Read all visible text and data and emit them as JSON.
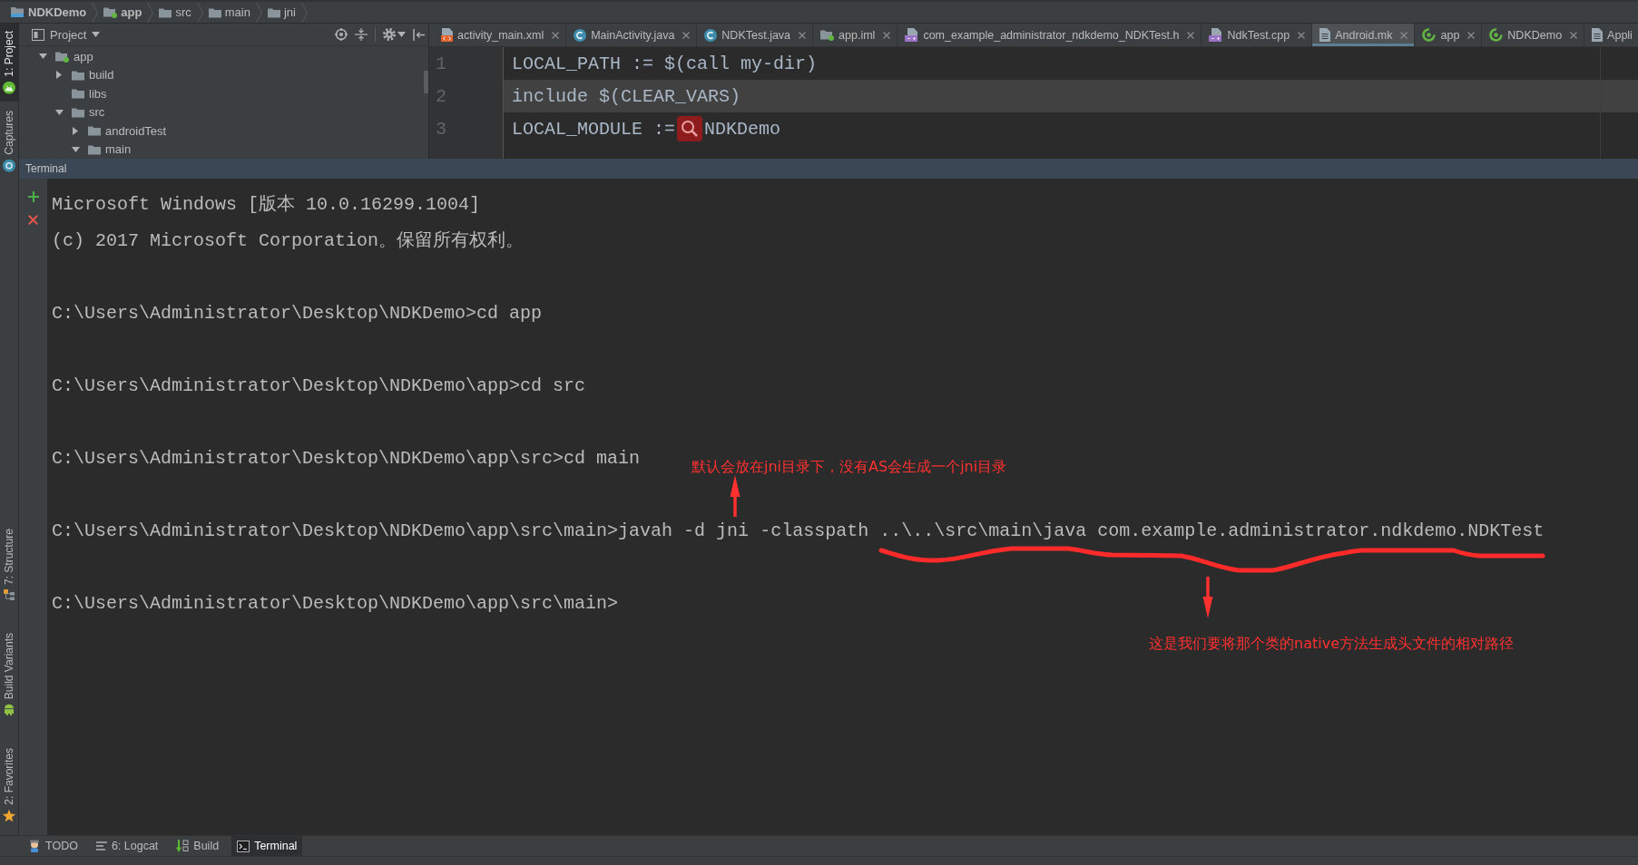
{
  "breadcrumb": [
    {
      "label": "NDKDemo",
      "kind": "project"
    },
    {
      "label": "app",
      "kind": "module"
    },
    {
      "label": "src",
      "kind": "folder"
    },
    {
      "label": "main",
      "kind": "folder"
    },
    {
      "label": "jni",
      "kind": "folder"
    }
  ],
  "tool_strip": {
    "top": [
      {
        "label": "1: Project",
        "kind": "project",
        "selected": true
      },
      {
        "label": "Captures",
        "kind": "captures",
        "selected": false
      }
    ],
    "bottom": [
      {
        "label": "7: Structure",
        "kind": "structure",
        "selected": false
      },
      {
        "label": "Build Variants",
        "kind": "build_variants",
        "selected": false
      },
      {
        "label": "2: Favorites",
        "kind": "favorites",
        "selected": false
      }
    ]
  },
  "project_panel": {
    "title": "Project",
    "tree": [
      {
        "label": "app",
        "kind": "module",
        "expanded": true,
        "children": [
          {
            "label": "build",
            "kind": "folder",
            "expanded": false
          },
          {
            "label": "libs",
            "kind": "folder"
          },
          {
            "label": "src",
            "kind": "folder",
            "expanded": true,
            "children": [
              {
                "label": "androidTest",
                "kind": "folder",
                "expanded": false
              },
              {
                "label": "main",
                "kind": "folder",
                "expanded": true
              }
            ]
          }
        ]
      }
    ]
  },
  "editor": {
    "tabs": [
      {
        "label": "activity_main.xml",
        "kind": "xml",
        "selected": false,
        "closable": true
      },
      {
        "label": "MainActivity.java",
        "kind": "class",
        "selected": false,
        "closable": true
      },
      {
        "label": "NDKTest.java",
        "kind": "class",
        "selected": false,
        "closable": true
      },
      {
        "label": "app.iml",
        "kind": "module",
        "selected": false,
        "closable": true
      },
      {
        "label": "com_example_administrator_ndkdemo_NDKTest.h",
        "kind": "cpp",
        "selected": false,
        "closable": true
      },
      {
        "label": "NdkTest.cpp",
        "kind": "cpp",
        "selected": false,
        "closable": true
      },
      {
        "label": "Android.mk",
        "kind": "text",
        "selected": true,
        "closable": true
      },
      {
        "label": "app",
        "kind": "gradle",
        "selected": false,
        "closable": true
      },
      {
        "label": "NDKDemo",
        "kind": "gradle",
        "selected": false,
        "closable": true
      },
      {
        "label": "Appli",
        "kind": "text",
        "selected": false,
        "closable": false
      }
    ],
    "lines": [
      {
        "number": "1",
        "kind": "plain",
        "text": "LOCAL_PATH := $(call my-dir)",
        "current": false
      },
      {
        "number": "2",
        "kind": "plain",
        "text": "include $(CLEAR_VARS)",
        "current": true
      },
      {
        "number": "3",
        "kind": "marked",
        "text": "LOCAL_MODULE :=",
        "text_after": "NDKDemo",
        "current": false
      }
    ]
  },
  "terminal": {
    "title": "Terminal",
    "blocks": [
      [
        "Microsoft Windows [版本 10.0.16299.1004]",
        "(c) 2017 Microsoft Corporation。保留所有权利。"
      ],
      [
        "C:\\Users\\Administrator\\Desktop\\NDKDemo>cd app"
      ],
      [
        "C:\\Users\\Administrator\\Desktop\\NDKDemo\\app>cd src"
      ],
      [
        "C:\\Users\\Administrator\\Desktop\\NDKDemo\\app\\src>cd main"
      ],
      [
        "C:\\Users\\Administrator\\Desktop\\NDKDemo\\app\\src\\main>javah -d jni -classpath ..\\..\\src\\main\\java com.example.administrator.ndkdemo.NDKTest"
      ],
      [
        "C:\\Users\\Administrator\\Desktop\\NDKDemo\\app\\src\\main>"
      ]
    ],
    "annotations": [
      {
        "text": "默认会放在jni目录下，没有AS会生成一个jni目录"
      },
      {
        "text": "这是我们要将那个类的native方法生成头文件的相对路径"
      }
    ]
  },
  "bottom_bar": [
    {
      "label": "TODO",
      "kind": "todo",
      "selected": false
    },
    {
      "label": "6: Logcat",
      "kind": "logcat",
      "selected": false
    },
    {
      "label": "Build",
      "kind": "build",
      "selected": false
    },
    {
      "label": "Terminal",
      "kind": "terminal",
      "selected": true
    }
  ]
}
